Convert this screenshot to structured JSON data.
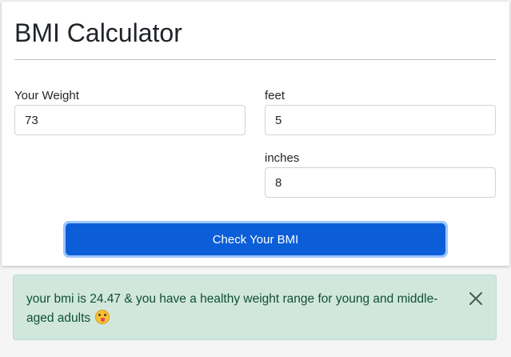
{
  "title": "BMI Calculator",
  "form": {
    "weight": {
      "label": "Your Weight",
      "value": "73"
    },
    "feet": {
      "label": "feet",
      "value": "5"
    },
    "inches": {
      "label": "inches",
      "value": "8"
    },
    "submit_label": "Check Your BMI"
  },
  "result": {
    "message": "your bmi is 24.47 & you have a healthy weight range for young and middle-aged adults",
    "emoji_icon": "face-with-tongue-icon",
    "close_icon": "close-icon"
  },
  "colors": {
    "button": "#0b5ed7",
    "alert_background": "#d1e7dd",
    "alert_text": "#0f5132"
  }
}
